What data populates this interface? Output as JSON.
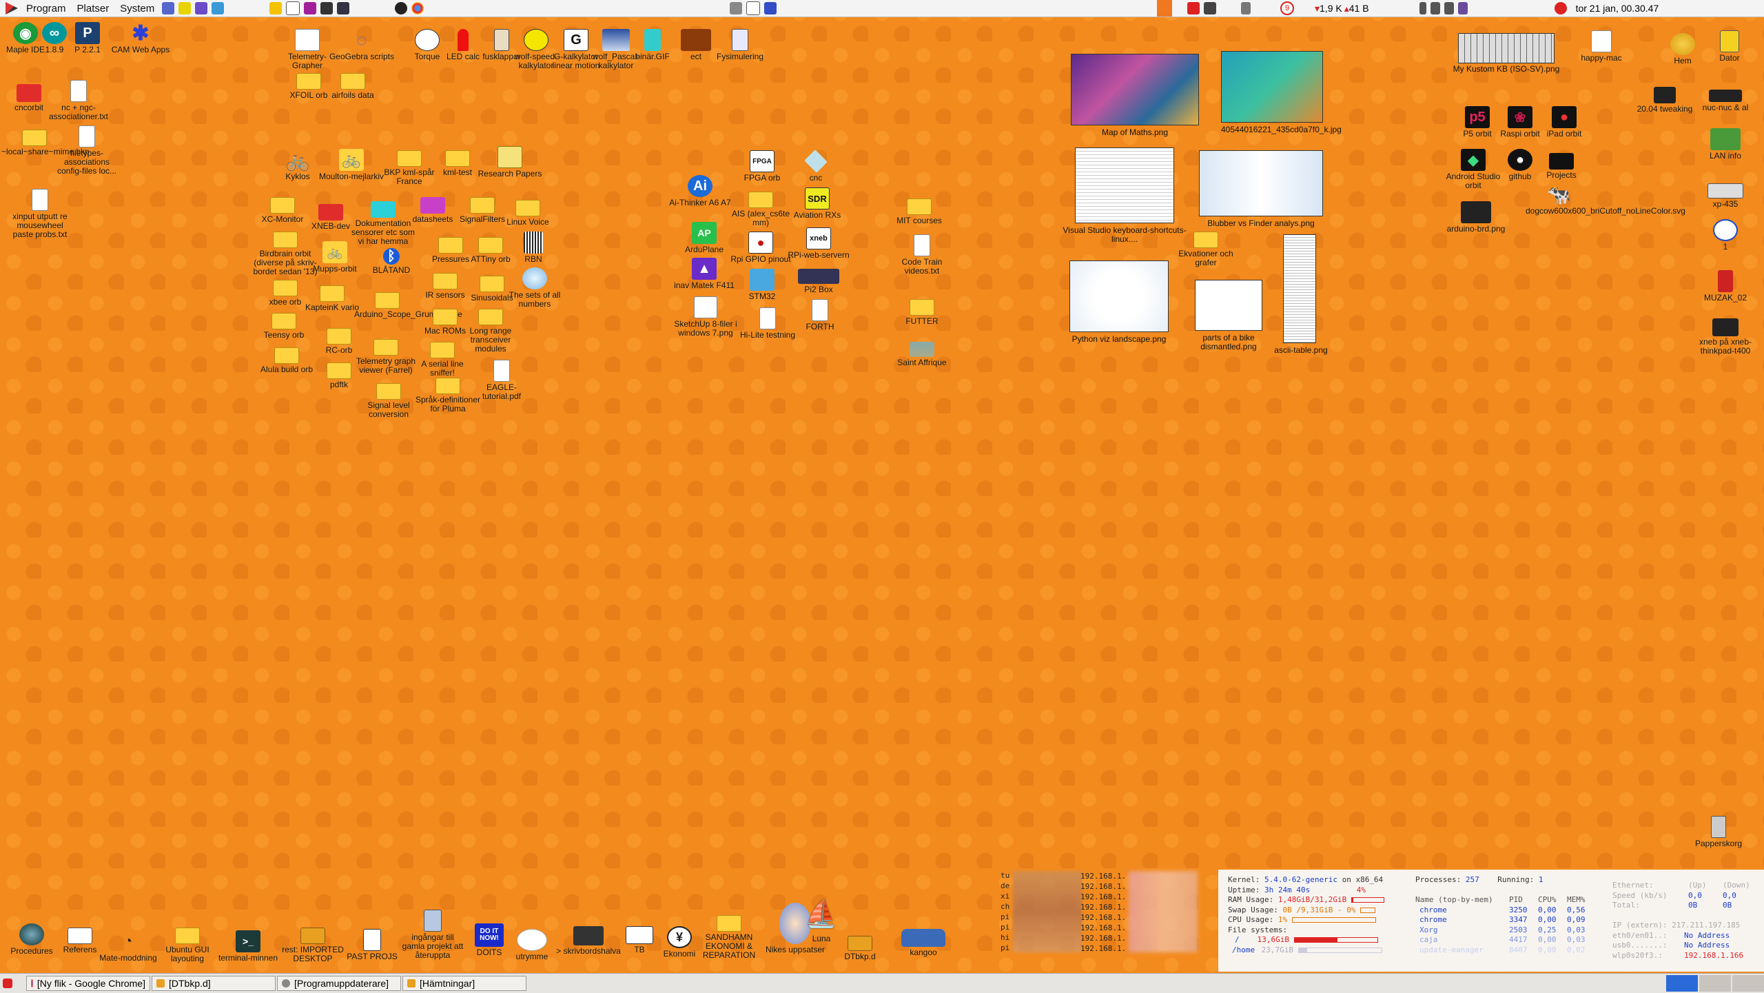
{
  "top_panel": {
    "menus": [
      "Program",
      "Platser",
      "System"
    ],
    "network": "1,9 K",
    "network2": "41 B",
    "badge": "9",
    "clock": "tor 21 jan, 00.30.47"
  },
  "desktop_icons": [
    {
      "name": "maple-ide",
      "label": "Maple IDE",
      "glyph": "◉",
      "color": "#1a9a3a",
      "pos": "a"
    },
    {
      "name": "arduino",
      "label": "1.8.9",
      "glyph": "∞",
      "color": "#00979c",
      "pos": "b"
    },
    {
      "name": "processing",
      "label": "P 2.2.1",
      "glyph": "P",
      "color": "#1c4070",
      "pos": "c"
    },
    {
      "name": "cam-web-apps",
      "label": "CAM Web Apps",
      "glyph": "✱",
      "color": "#2a3fd8",
      "pos": "d"
    }
  ],
  "labels": {
    "cncorbit": "cncorbit",
    "nc_ngc": "nc + ngc-associationer.txt",
    "local_share": "~local~share~mime.bkp",
    "filetypes": "filetypes-associations config-files loc...",
    "xinput": "xinput utputt re mousewheel paste probs.txt",
    "telemetry_grapher": "Telemetry-Grapher",
    "geogebra": "GeoGebra scripts",
    "torque": "Torque",
    "led_calc": "LED calc",
    "fusklappar": "fusklappar",
    "wolf_speed": "wolf-speed-kalkylator",
    "g_kalk": "G-kalkylator linear motion",
    "wolf_pascal": "wolf_Pascal-kalkylator",
    "binar": "binär.GIF",
    "ect": "ect",
    "fysimulering": "Fysimulering",
    "xfoil": "XFOIL orb",
    "airfoils": "airfoils data",
    "kyklos": "Kyklos",
    "moulton": "Moulton-mejlarkiv",
    "bkp_kml": "BKP kml-spår France",
    "kml_test": "kml-test",
    "research": "Research Papers",
    "xc_monitor": "XC-Monitor",
    "xneb_dev": "XNEB-dev",
    "dokumentation": "Dokumentation sensorer etc som vi har hemma",
    "datasheets": "datasheets",
    "signalfilters": "SignalFilters",
    "linux_voice": "Linux Voice",
    "birdbrain": "Birdbrain orbit (diverse på skriv-bordet sedan '13)",
    "mupps": "Mupps-orbit",
    "blatand": "BLÅTAND",
    "pressures": "Pressures",
    "attiny": "ATTiny orb",
    "rbn": "RBN",
    "ir_sensors": "IR sensors",
    "sinusoidals": "Sinusoidals",
    "sets_numbers": "The sets of all numbers",
    "xbee": "xbee orb",
    "kaptenk": "KapteinK vario",
    "arduino_scope": "Arduino_Scope_GrumpyMike",
    "mac_roms": "Mac ROMs",
    "long_range": "Long range transceiver modules",
    "teensy": "Teensy orb",
    "rc_orb": "RC-orb",
    "telemetry_viewer": "Telemetry graph viewer (Farrel)",
    "serial_line": "A serial line sniffer!",
    "alula": "Alula build orb",
    "pdftk": "pdftk",
    "eagle": "EAGLE-tutorial.pdf",
    "signal_level": "Signal level conversion",
    "sprak": "Språk-definitioner för Pluma",
    "fpga_orb": "FPGA orb",
    "cnc": "cnc",
    "ai_thinker": "Ai-Thinker A6 A7",
    "ais": "AIS (alex_cs6te mm)",
    "aviation": "Aviation RXs",
    "ardupilane": "ArduPlane",
    "rpi_gpio": "Rpi GPIO pinout",
    "rpi_web": "RPi-web-servern",
    "inav": "inav Matek F411",
    "stm32": "STM32",
    "pi2box": "Pi2 Box",
    "sketchup": "SketchUp 8-filer i windows 7.png",
    "hilite": "Hi-Lite testning",
    "forth": "FORTH",
    "mit": "MIT courses",
    "code_train": "Code Train videos.txt",
    "futter": "FUTTER",
    "saint": "Saint Affrique",
    "map_maths": "Map of Maths.png",
    "img_4054": "40544016221_435cd0a7f0_k.jpg",
    "vs_keyboard": "Visual Studio keyboard-shortcuts-linux....",
    "blubber": "Blubber vs Finder analys.png",
    "ekvationer": "Ekvationer och grafer",
    "python_viz": "Python viz landscape.png",
    "bike": "parts of a bike dismantled.png",
    "ascii": "ascii-table.png",
    "kustom_kb": "My Kustom KB (ISO-SV).png",
    "happy_mac": "happy-mac",
    "hem": "Hem",
    "dator": "Dator",
    "tweaking": "20.04 tweaking",
    "nuc": "nuc-nuc & al",
    "p5": "P5 orbit",
    "raspi": "Raspi orbit",
    "ipad": "iPad orbit",
    "lan": "LAN info",
    "android": "Android Studio orbit",
    "github": "github",
    "projects": "Projects",
    "xp435": "xp-435",
    "arduino_brd": "arduino-brd.png",
    "dogcow": "dogcow600x600_briCutoff_noLineColor.svg",
    "one": "1",
    "muzak": "MUZAK_02",
    "xneb_thinkpad": "xneb på xneb-thinkpad-t400",
    "papperskorg": "Papperskorg",
    "procedures": "Procedures",
    "referens": "Referens",
    "mate": "Mate-moddning",
    "ubuntu_gui": "Ubuntu GUI layouting",
    "terminal": "terminal-minnen",
    "rest_imported": "rest: IMPORTED DESKTOP",
    "past_projs": "PAST PROJS",
    "ingangar": "ingångar till gamla projekt att återuppta",
    "doits": "DOITS",
    "utrymme": "utrymme",
    "skrivbordshalva": "> skrivbordshalva",
    "tb": "TB",
    "ekonomi": "Ekonomi",
    "sandhamn": "SANDHAMN EKONOMI & REPARATION",
    "nikes": "Nikes uppsatser",
    "luna": "Luna",
    "dtbkp": "DTbkp.d",
    "kangoo": "kangoo"
  },
  "doits_text": "DO IT NOW!",
  "conky": {
    "kernel_label": "Kernel:",
    "kernel": "5.4.0-62-generic",
    "kernel_arch": "on x86_64",
    "uptime_label": "Uptime:",
    "uptime": "3h 24m 40s",
    "uptime_pct": "4%",
    "ram_label": "RAM Usage:",
    "ram": "1,48GiB/31,2GiB",
    "swap_label": "Swap Usage:",
    "swap": "0B  /9,31GiB - 0%",
    "cpu_label": "CPU Usage:",
    "cpu": "1%",
    "fs_label": "File systems:",
    "fs_root": "/",
    "fs_root_val": "13,6GiB",
    "fs_home": "/home",
    "fs_home_val": "23,7GiB",
    "proc_label": "Processes:",
    "processes": "257",
    "running_label": "Running:",
    "running": "1",
    "proc_headers": [
      "Name (top-by-mem)",
      "PID",
      "CPU%",
      "MEM%"
    ],
    "procs": [
      [
        "chrome",
        "3250",
        "0,00",
        "0,56"
      ],
      [
        "chrome",
        "3347",
        "0,00",
        "0,09"
      ],
      [
        "Xorg",
        "2503",
        "0,25",
        "0,03"
      ],
      [
        "caja",
        "4417",
        "0,00",
        "0,03"
      ],
      [
        "update-manager",
        "8407",
        "0,00",
        "0,02"
      ]
    ],
    "net_headers": [
      "Ethernet:",
      "(Up)",
      "(Down)"
    ],
    "speed_label": "Speed (kb/s)",
    "speed_up": "0,0",
    "speed_down": "0,0",
    "total_label": "Total:",
    "total_up": "0B",
    "total_down": "0B",
    "ip_extern": "IP (extern): 217.211.197.185",
    "eth0": "eth0/en01..:",
    "eth0_val": "No Address",
    "usb0": "usb0.......:",
    "usb0_val": "No Address",
    "wlp": "wlp0s20f3.:",
    "wlp_val": "192.168.1.166"
  },
  "netlist": [
    "tu",
    "de",
    "xi",
    "ch",
    "pi",
    "pi",
    "hi",
    "pi"
  ],
  "netlist_ip": "192.168.1.",
  "taskbar": {
    "tasks": [
      "[Ny flik - Google Chrome]",
      "[DTbkp.d]",
      "[Programuppdaterare]",
      "[Hämtningar]"
    ]
  }
}
